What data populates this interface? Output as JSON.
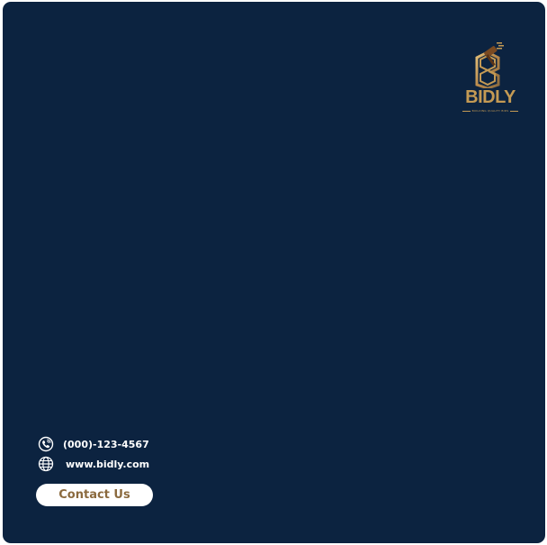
{
  "brand": {
    "name": "BIDLY",
    "tagline": "BUILDING QUALITY BIDS",
    "logo_icon": "stacked-letters-with-gavel-logo",
    "gold": "#c49a54",
    "gold_dark": "#8b6a3e"
  },
  "background_color": "#0c2340",
  "contact": {
    "phone": "(000)-123-4567",
    "phone_icon": "phone-icon",
    "website": "www.bidly.com",
    "website_icon": "globe-icon",
    "button_label": "Contact Us"
  }
}
